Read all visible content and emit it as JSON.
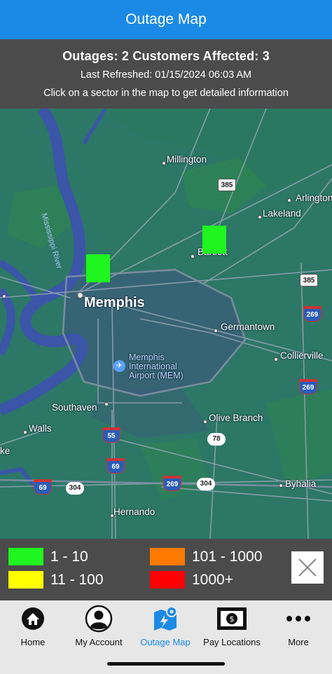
{
  "header": {
    "title": "Outage Map"
  },
  "summary": {
    "outages_label": "Outages:",
    "outages_value": "2",
    "customers_label": "Customers Affected:",
    "customers_value": "3",
    "last_refreshed": "Last Refreshed: 01/15/2024 06:03 AM",
    "hint": "Click on a sector in the map to get detailed information"
  },
  "map": {
    "places": {
      "millington": "Millington",
      "arlington": "Arlington",
      "lakeland": "Lakeland",
      "bartlett": "Bartlett",
      "memphis": "Memphis",
      "germantown": "Germantown",
      "collierville": "Collierville",
      "airport": "Memphis\nInternational\nAirport (MEM)",
      "southaven": "Southaven",
      "walls": "Walls",
      "olive_branch": "Olive Branch",
      "byhalia": "Byhalia",
      "hernando": "Hernando",
      "ke": "ke",
      "river": "Mississippi River"
    },
    "highways": {
      "us385_top": "385",
      "us385_right": "385",
      "i269_a": "269",
      "i269_b": "269",
      "i269_c": "269",
      "i55": "55",
      "i69_a": "69",
      "i69_b": "69",
      "s304_a": "304",
      "s304_b": "304",
      "s78": "78"
    },
    "colors": {
      "land": "#2c7766",
      "water": "#3b55a8",
      "sector": "#1ff51f"
    }
  },
  "legend": {
    "items": [
      {
        "label": "1 - 10",
        "color": "#1ff51f"
      },
      {
        "label": "11 - 100",
        "color": "#ffff00"
      },
      {
        "label": "101 - 1000",
        "color": "#ff7a00"
      },
      {
        "label": "1000+",
        "color": "#ff0000"
      }
    ],
    "close_icon": "close-x-icon"
  },
  "tabs": [
    {
      "label": "Home",
      "icon": "home-icon"
    },
    {
      "label": "My Account",
      "icon": "account-icon"
    },
    {
      "label": "Outage Map",
      "icon": "map-icon",
      "active": true
    },
    {
      "label": "Pay Locations",
      "icon": "money-icon"
    },
    {
      "label": "More",
      "icon": "more-icon"
    }
  ],
  "accent_color": "#1a8ae6"
}
